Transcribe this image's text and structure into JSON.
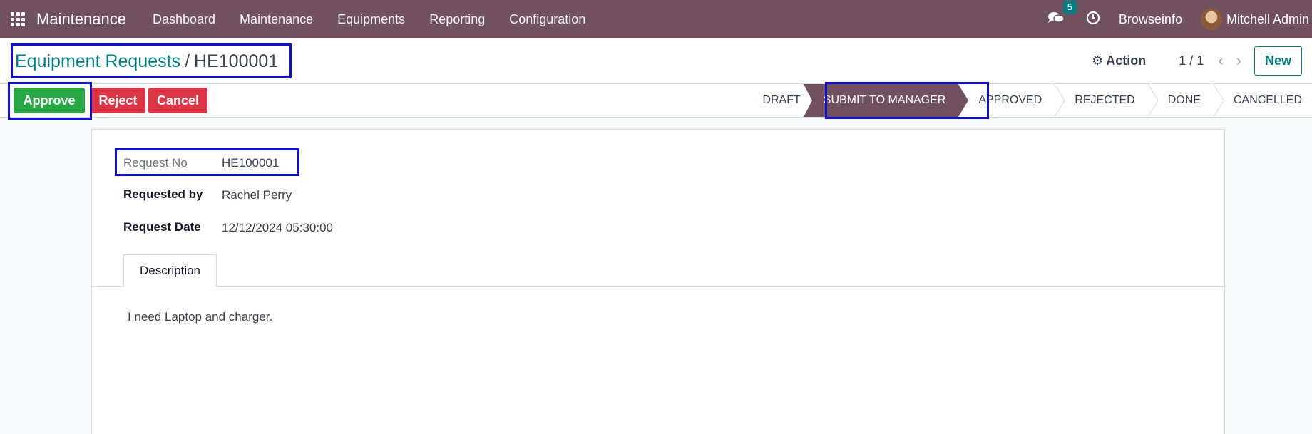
{
  "navbar": {
    "brand": "Maintenance",
    "menu": [
      "Dashboard",
      "Maintenance",
      "Equipments",
      "Reporting",
      "Configuration"
    ],
    "chat_count": "5",
    "company": "Browseinfo",
    "user": "Mitchell Admin"
  },
  "breadcrumb": {
    "parent": "Equipment Requests",
    "separator": "/",
    "current": "HE100001"
  },
  "toolbar": {
    "action_label": "Action",
    "pager": "1 / 1",
    "new_label": "New"
  },
  "buttons": {
    "approve": "Approve",
    "reject": "Reject",
    "cancel": "Cancel"
  },
  "status": {
    "stages": [
      "DRAFT",
      "SUBMIT TO MANAGER",
      "APPROVED",
      "REJECTED",
      "DONE",
      "CANCELLED"
    ],
    "active": "SUBMIT TO MANAGER"
  },
  "form": {
    "request_no_label": "Request No",
    "request_no": "HE100001",
    "requested_by_label": "Requested by",
    "requested_by": "Rachel Perry",
    "request_date_label": "Request Date",
    "request_date": "12/12/2024 05:30:00",
    "tab_label": "Description",
    "description": "I need Laptop and charger."
  },
  "colors": {
    "navbar": "#71505f",
    "accent": "#017e84",
    "approve": "#28a745",
    "danger": "#dc3545",
    "highlight": "#1010d0"
  }
}
